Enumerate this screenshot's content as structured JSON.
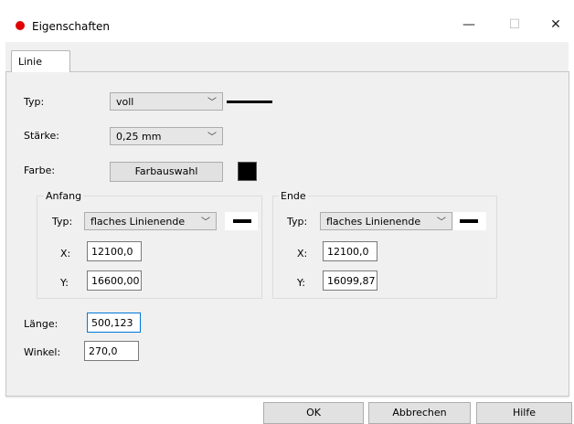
{
  "window": {
    "title": "Eigenschaften",
    "minimize_glyph": "—",
    "maximize_glyph": "☐",
    "close_glyph": "✕"
  },
  "tabs": [
    {
      "label": "Linie"
    }
  ],
  "form": {
    "typ_label": "Typ:",
    "typ_value": "voll",
    "staerke_label": "Stärke:",
    "staerke_value": "0,25 mm",
    "farbe_label": "Farbe:",
    "farbe_button": "Farbauswahl",
    "color_swatch": "#000000"
  },
  "anfang": {
    "title": "Anfang",
    "typ_label": "Typ:",
    "typ_value": "flaches Linienende",
    "x_label": "X:",
    "x_value": "12100,0",
    "y_label": "Y:",
    "y_value": "16600,00"
  },
  "ende": {
    "title": "Ende",
    "typ_label": "Typ:",
    "typ_value": "flaches Linienende",
    "x_label": "X:",
    "x_value": "12100,0",
    "y_label": "Y:",
    "y_value": "16099,87"
  },
  "laenge": {
    "label": "Länge:",
    "value": "500,123"
  },
  "winkel": {
    "label": "Winkel:",
    "value": "270,0"
  },
  "footer": {
    "ok": "OK",
    "cancel": "Abbrechen",
    "help": "Hilfe"
  },
  "icons": {
    "app": "red-dot-icon",
    "dropdown": "chevron-down-icon",
    "chevron_glyph": "﹀"
  }
}
